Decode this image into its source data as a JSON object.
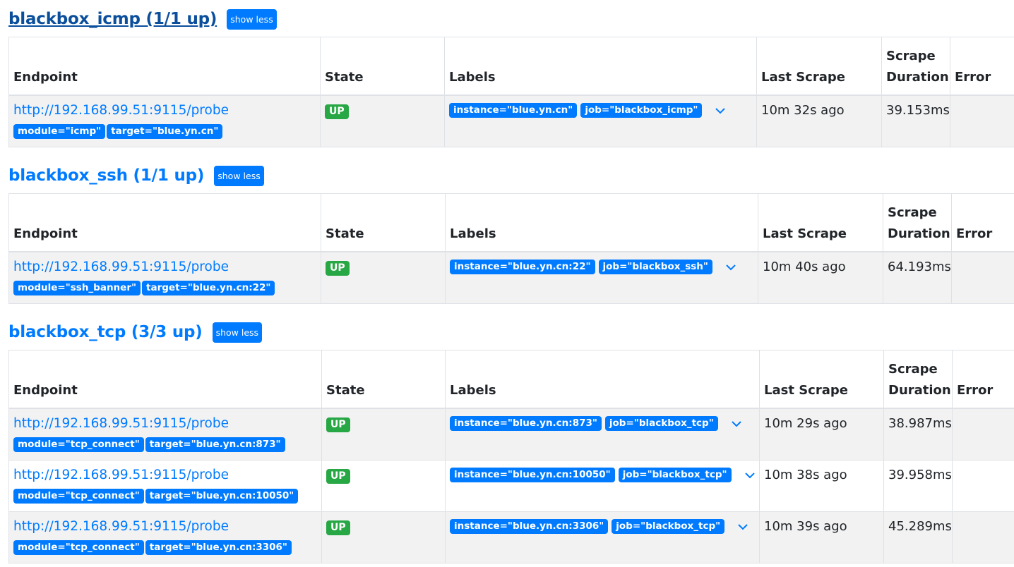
{
  "columns": {
    "endpoint": "Endpoint",
    "state": "State",
    "labels": "Labels",
    "last_scrape": "Last Scrape",
    "scrape_duration_1": "Scrape",
    "scrape_duration_2": "Duration",
    "error": "Error"
  },
  "colors": {
    "accent": "#007bff",
    "up": "#28a745",
    "visited": "#0b4f9c"
  },
  "pools": [
    {
      "title": "blackbox_icmp (1/1 up)",
      "toggle": "show less",
      "rows": [
        {
          "endpoint": "http://192.168.99.51:9115/probe",
          "params": [
            "module=\"icmp\"",
            "target=\"blue.yn.cn\""
          ],
          "state": "UP",
          "labels": [
            "instance=\"blue.yn.cn\"",
            "job=\"blackbox_icmp\""
          ],
          "last_scrape": "10m 32s ago",
          "duration": "39.153ms",
          "error": ""
        }
      ]
    },
    {
      "title": "blackbox_ssh (1/1 up)",
      "toggle": "show less",
      "rows": [
        {
          "endpoint": "http://192.168.99.51:9115/probe",
          "params": [
            "module=\"ssh_banner\"",
            "target=\"blue.yn.cn:22\""
          ],
          "state": "UP",
          "labels": [
            "instance=\"blue.yn.cn:22\"",
            "job=\"blackbox_ssh\""
          ],
          "last_scrape": "10m 40s ago",
          "duration": "64.193ms",
          "error": ""
        }
      ]
    },
    {
      "title": "blackbox_tcp (3/3 up)",
      "toggle": "show less",
      "rows": [
        {
          "endpoint": "http://192.168.99.51:9115/probe",
          "params": [
            "module=\"tcp_connect\"",
            "target=\"blue.yn.cn:873\""
          ],
          "state": "UP",
          "labels": [
            "instance=\"blue.yn.cn:873\"",
            "job=\"blackbox_tcp\""
          ],
          "last_scrape": "10m 29s ago",
          "duration": "38.987ms",
          "error": ""
        },
        {
          "endpoint": "http://192.168.99.51:9115/probe",
          "params": [
            "module=\"tcp_connect\"",
            "target=\"blue.yn.cn:10050\""
          ],
          "state": "UP",
          "labels": [
            "instance=\"blue.yn.cn:10050\"",
            "job=\"blackbox_tcp\""
          ],
          "last_scrape": "10m 38s ago",
          "duration": "39.958ms",
          "error": ""
        },
        {
          "endpoint": "http://192.168.99.51:9115/probe",
          "params": [
            "module=\"tcp_connect\"",
            "target=\"blue.yn.cn:3306\""
          ],
          "state": "UP",
          "labels": [
            "instance=\"blue.yn.cn:3306\"",
            "job=\"blackbox_tcp\""
          ],
          "last_scrape": "10m 39s ago",
          "duration": "45.289ms",
          "error": ""
        }
      ]
    }
  ]
}
